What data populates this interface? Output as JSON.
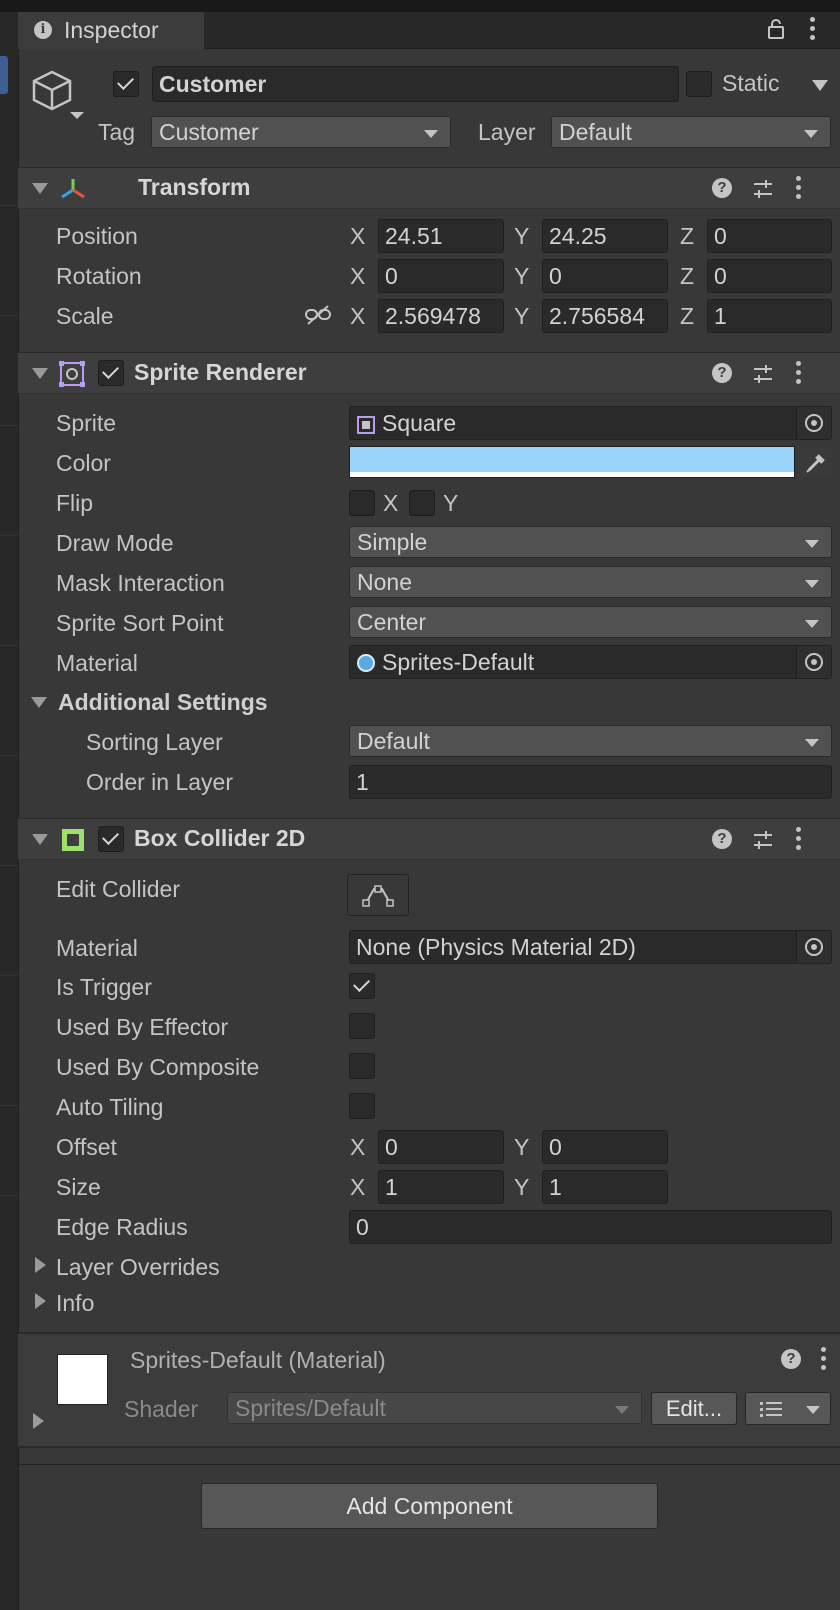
{
  "tab": {
    "title": "Inspector"
  },
  "header": {
    "enabled": true,
    "object_name": "Customer",
    "static_label": "Static",
    "static_checked": false,
    "tag_label": "Tag",
    "tag_value": "Customer",
    "layer_label": "Layer",
    "layer_value": "Default"
  },
  "transform": {
    "title": "Transform",
    "position_label": "Position",
    "position": {
      "x": "24.51",
      "y": "24.25",
      "z": "0"
    },
    "rotation_label": "Rotation",
    "rotation": {
      "x": "0",
      "y": "0",
      "z": "0"
    },
    "scale_label": "Scale",
    "scale": {
      "x": "2.569478",
      "y": "2.756584",
      "z": "1"
    },
    "axis_x": "X",
    "axis_y": "Y",
    "axis_z": "Z"
  },
  "sprite_renderer": {
    "title": "Sprite Renderer",
    "enabled": true,
    "sprite_label": "Sprite",
    "sprite_value": "Square",
    "color_label": "Color",
    "color_value": "#9bd4fb",
    "flip_label": "Flip",
    "flip_x": "X",
    "flip_y": "Y",
    "draw_mode_label": "Draw Mode",
    "draw_mode": "Simple",
    "mask_label": "Mask Interaction",
    "mask": "None",
    "sort_point_label": "Sprite Sort Point",
    "sort_point": "Center",
    "material_label": "Material",
    "material": "Sprites-Default",
    "additional_label": "Additional Settings",
    "sorting_layer_label": "Sorting Layer",
    "sorting_layer": "Default",
    "order_label": "Order in Layer",
    "order": "1"
  },
  "box_collider": {
    "title": "Box Collider 2D",
    "enabled": true,
    "edit_label": "Edit Collider",
    "material_label": "Material",
    "material": "None (Physics Material 2D)",
    "trigger_label": "Is Trigger",
    "trigger": true,
    "effector_label": "Used By Effector",
    "effector": false,
    "composite_label": "Used By Composite",
    "composite": false,
    "tiling_label": "Auto Tiling",
    "tiling": false,
    "offset_label": "Offset",
    "offset": {
      "x": "0",
      "y": "0"
    },
    "size_label": "Size",
    "size": {
      "x": "1",
      "y": "1"
    },
    "edge_label": "Edge Radius",
    "edge": "0",
    "overrides_label": "Layer Overrides",
    "info_label": "Info"
  },
  "material_panel": {
    "title": "Sprites-Default",
    "subtitle": "(Material)",
    "shader_label": "Shader",
    "shader_value": "Sprites/Default",
    "edit_button": "Edit..."
  },
  "add_component": "Add Component"
}
